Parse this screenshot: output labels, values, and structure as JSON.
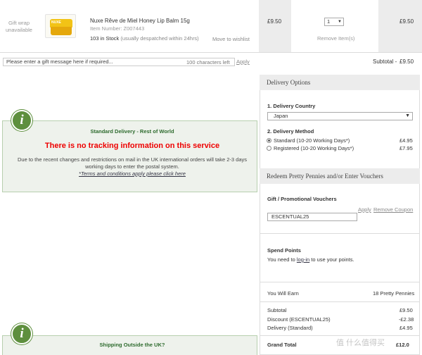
{
  "cart": {
    "gift_wrap": "Gift wrap unavailable",
    "product": {
      "name": "Nuxe Rêve de Miel Honey Lip Balm 15g",
      "item_number": "Item Number: Z007443",
      "stock": "103 in Stock",
      "stock_note": "(usually despatched within 24hrs)",
      "move_to_wishlist": "Move to wishlist",
      "thumb_brand": "NUXE",
      "unit_price": "£9.50",
      "quantity": "1",
      "remove": "Remove Item(s)",
      "line_total": "£9.50"
    },
    "gift_message": {
      "placeholder": "Please enter a gift message here if required...",
      "chars_left": "100 characters left",
      "apply": "Apply"
    },
    "subtotal_label": "Subtotal -",
    "subtotal_value": "£9.50"
  },
  "notice": {
    "title": "Standard Delivery - Rest of World",
    "headline": "There is no tracking information on this service",
    "body": "Due to the recent changes and restrictions on mail in the UK international orders will take 2-3 days working days to enter the postal system.",
    "terms": "*Terms and conditions apply please click here",
    "badge": "i"
  },
  "notice2": {
    "title": "Shipping Outside the UK?",
    "badge": "i"
  },
  "delivery": {
    "heading": "Delivery Options",
    "country_label": "1. Delivery Country",
    "country_value": "Japan",
    "method_label": "2. Delivery Method",
    "options": [
      {
        "label": "Standard (10-20 Working Days*)",
        "price": "£4.95",
        "selected": true
      },
      {
        "label": "Registered (10-20 Working Days*)",
        "price": "£7.95",
        "selected": false
      }
    ]
  },
  "vouchers": {
    "heading": "Redeem Pretty Pennies and/or Enter Vouchers",
    "label": "Gift / Promotional Vouchers",
    "apply": "Apply",
    "remove": "Remove Coupon",
    "code": "ESCENTUAL25"
  },
  "points": {
    "label": "Spend Points",
    "text_before": "You need to",
    "link": "log-in",
    "text_after": "to use your points."
  },
  "summary": {
    "earn_label": "You Will Earn",
    "earn_value": "18 Pretty Pennies",
    "rows": [
      {
        "label": "Subtotal",
        "value": "£9.50"
      },
      {
        "label": "Discount (ESCENTUAL25)",
        "value": "-£2.38"
      },
      {
        "label": "Delivery (Standard)",
        "value": "£4.95"
      }
    ],
    "grand_label": "Grand Total",
    "grand_value": "£12.0"
  },
  "watermark": "值 什么值得买"
}
